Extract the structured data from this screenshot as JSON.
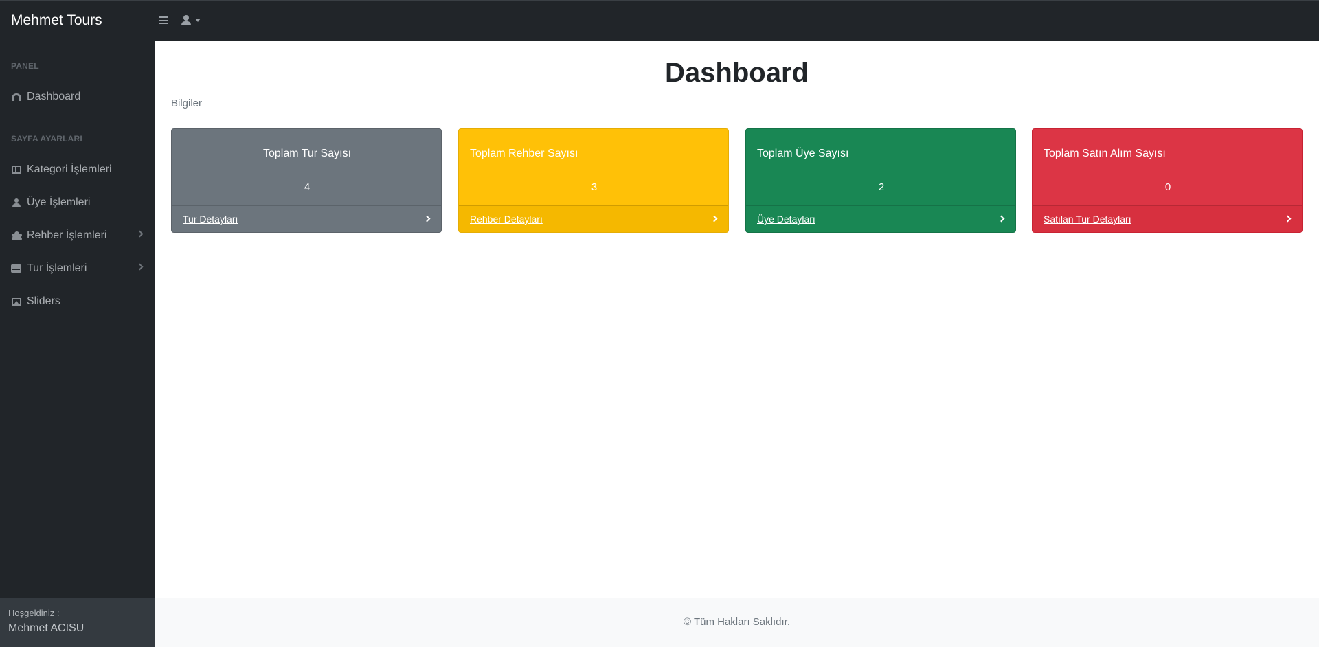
{
  "brand": "Mehmet Tours",
  "sidebar": {
    "headings": [
      "PANEL",
      "SAYFA AYARLARI"
    ],
    "items": [
      {
        "label": "Dashboard",
        "icon": "gauge-icon"
      },
      {
        "label": "Kategori İşlemleri",
        "icon": "table-icon"
      },
      {
        "label": "Üye İşlemleri",
        "icon": "user-icon"
      },
      {
        "label": "Rehber İşlemleri",
        "icon": "users-icon",
        "has_submenu": true
      },
      {
        "label": "Tur İşlemleri",
        "icon": "store-icon",
        "has_submenu": true
      },
      {
        "label": "Sliders",
        "icon": "image-icon"
      }
    ],
    "footer": {
      "welcome": "Hoşgeldiniz :",
      "user": "Mehmet ACISU"
    }
  },
  "main": {
    "title": "Dashboard",
    "breadcrumb": "Bilgiler",
    "cards": [
      {
        "title": "Toplam Tur Sayısı",
        "value": "4",
        "link": "Tur Detayları",
        "color": "#6c757d"
      },
      {
        "title": "Toplam Rehber Sayısı",
        "value": "3",
        "link": "Rehber Detayları",
        "color": "#ffc107"
      },
      {
        "title": "Toplam Üye Sayısı",
        "value": "2",
        "link": "Üye Detayları",
        "color": "#198754"
      },
      {
        "title": "Toplam Satın Alım Sayısı",
        "value": "0",
        "link": "Satılan Tur Detayları",
        "color": "#dc3545"
      }
    ]
  },
  "footer": {
    "copyright": "© Tüm Hakları Saklıdır."
  }
}
